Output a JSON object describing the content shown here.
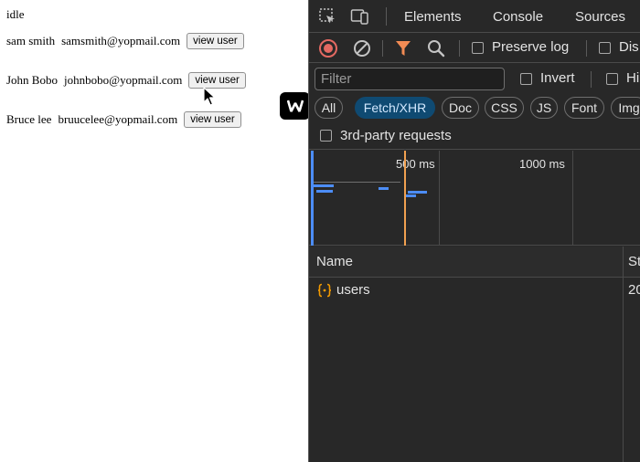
{
  "page": {
    "status_text": "idle",
    "view_button_label": "view user",
    "users": [
      {
        "name": "sam smith",
        "email": "samsmith@yopmail.com"
      },
      {
        "name": "John Bobo",
        "email": "johnbobo@yopmail.com"
      },
      {
        "name": "Bruce lee",
        "email": "bruucelee@yopmail.com"
      }
    ]
  },
  "badge": {
    "letter": "W"
  },
  "devtools": {
    "tabs": [
      {
        "label": "Elements"
      },
      {
        "label": "Console"
      },
      {
        "label": "Sources"
      }
    ],
    "toolbar": {
      "preserve_log_label": "Preserve log",
      "disable_cache_label": "Dis"
    },
    "filter": {
      "placeholder": "Filter",
      "invert_label": "Invert",
      "hide_label": "Hi"
    },
    "type_filters": [
      {
        "label": "All",
        "active": false
      },
      {
        "label": "Fetch/XHR",
        "active": true
      },
      {
        "label": "Doc",
        "active": false
      },
      {
        "label": "CSS",
        "active": false
      },
      {
        "label": "JS",
        "active": false
      },
      {
        "label": "Font",
        "active": false
      },
      {
        "label": "Img",
        "active": false
      }
    ],
    "third_party_label": "3rd-party requests",
    "overview": {
      "tick_labels": [
        "500 ms",
        "1000 ms"
      ]
    },
    "table": {
      "columns": [
        "Name",
        "St"
      ],
      "rows": [
        {
          "name": "users",
          "status": "20"
        }
      ]
    },
    "colors": {
      "record": "#e46962",
      "filter_funnel": "#f28b54",
      "fetch_icon": "#f29900",
      "active_chip": "#0f4a72",
      "timeline_bar": "#4c8df6",
      "timeline_marker": "#f0a050"
    }
  }
}
